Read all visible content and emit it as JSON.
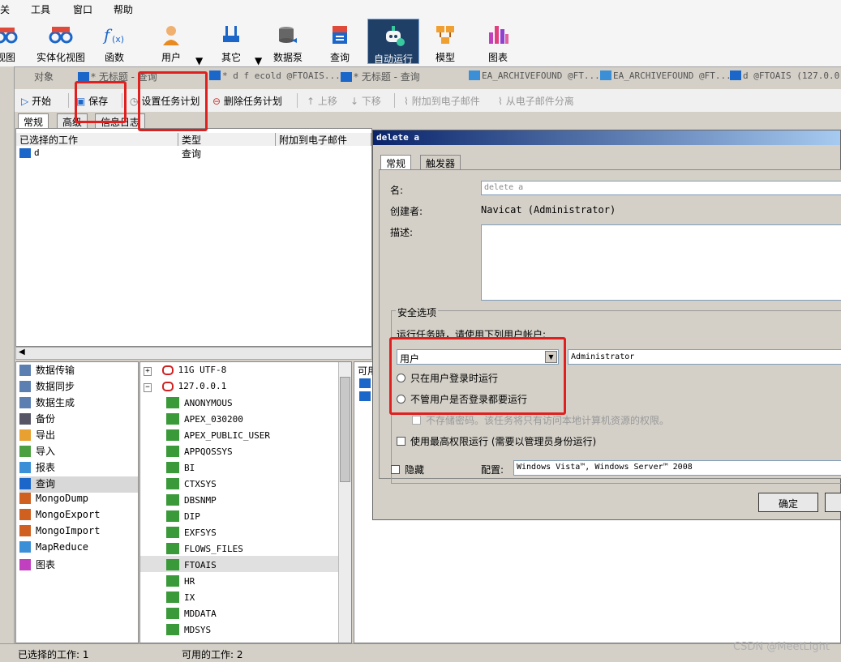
{
  "menu": [
    "关",
    "工具",
    "窗口",
    "帮助"
  ],
  "toolbar": {
    "items": [
      {
        "label": "视图"
      },
      {
        "label": "实体化视图"
      },
      {
        "label": "函数"
      },
      {
        "label": "用户"
      },
      {
        "label": "其它"
      },
      {
        "label": "数据泵"
      },
      {
        "label": "查询"
      },
      {
        "label": "自动运行"
      },
      {
        "label": "模型"
      },
      {
        "label": "图表"
      }
    ]
  },
  "tabs": [
    "对象",
    "* 无标题 - 查询",
    "* d f ecold @FTOAIS...",
    "* 无标题 - 查询",
    "EA_ARCHIVEFOUND @FT...",
    "EA_ARCHIVEFOUND @FT...",
    "d @FTOAIS (127.0.0..."
  ],
  "subtoolbar": {
    "start": "开始",
    "save": "保存",
    "set_schedule": "设置任务计划",
    "delete_schedule": "删除任务计划",
    "move_up": "上移",
    "move_down": "下移",
    "attach_email": "附加到电子邮件",
    "detach_email": "从电子邮件分离"
  },
  "inner_tabs": [
    "常规",
    "高级",
    "信息日志"
  ],
  "job_table": {
    "columns": [
      "已选择的工作",
      "类型",
      "附加到电子邮件"
    ],
    "rows": [
      {
        "name": "d",
        "type": "查询"
      }
    ]
  },
  "categories": [
    "数据传输",
    "数据同步",
    "数据生成",
    "备份",
    "导出",
    "导入",
    "报表",
    "查询",
    "MongoDump",
    "MongoExport",
    "MongoImport",
    "MapReduce",
    "图表"
  ],
  "tree": {
    "connections": [
      {
        "label": "11G UTF-8",
        "expander": "+"
      },
      {
        "label": "127.0.0.1",
        "expander": "−"
      }
    ],
    "schemas": [
      "ANONYMOUS",
      "APEX_030200",
      "APEX_PUBLIC_USER",
      "APPQOSSYS",
      "BI",
      "CTXSYS",
      "DBSNMP",
      "DIP",
      "EXFSYS",
      "FLOWS_FILES",
      "FTOAIS",
      "HR",
      "IX",
      "MDDATA",
      "MDSYS"
    ]
  },
  "avail_header": "可用",
  "status": {
    "selected": "已选择的工作: 1",
    "available": "可用的工作: 2"
  },
  "dialog": {
    "title": "delete a",
    "tabs": [
      "常规",
      "触发器"
    ],
    "name_label": "名:",
    "name_value": "delete a",
    "creator_label": "创建者:",
    "creator_value": "Navicat (Administrator)",
    "desc_label": "描述:",
    "security_group": "安全选项",
    "run_as_label": "运行任务時，请使用下列用户帐户:",
    "account_type": "用户",
    "account_name": "Administrator",
    "radio_logged_in": "只在用户登录时运行",
    "radio_always": "不管用户是否登录都要运行",
    "no_store_password": "不存储密码。该任务将只有访问本地计算机资源的权限。",
    "highest_priv": "使用最高权限运行 (需要以管理员身份运行)",
    "hidden": "隐藏",
    "config_label": "配置:",
    "config_value": "Windows Vista™, Windows Server™ 2008",
    "ok": "确定"
  },
  "watermark": "CSDN @MeetLight",
  "colors": {
    "highlight": "#e0201f",
    "title_bar": "#0a246a"
  }
}
